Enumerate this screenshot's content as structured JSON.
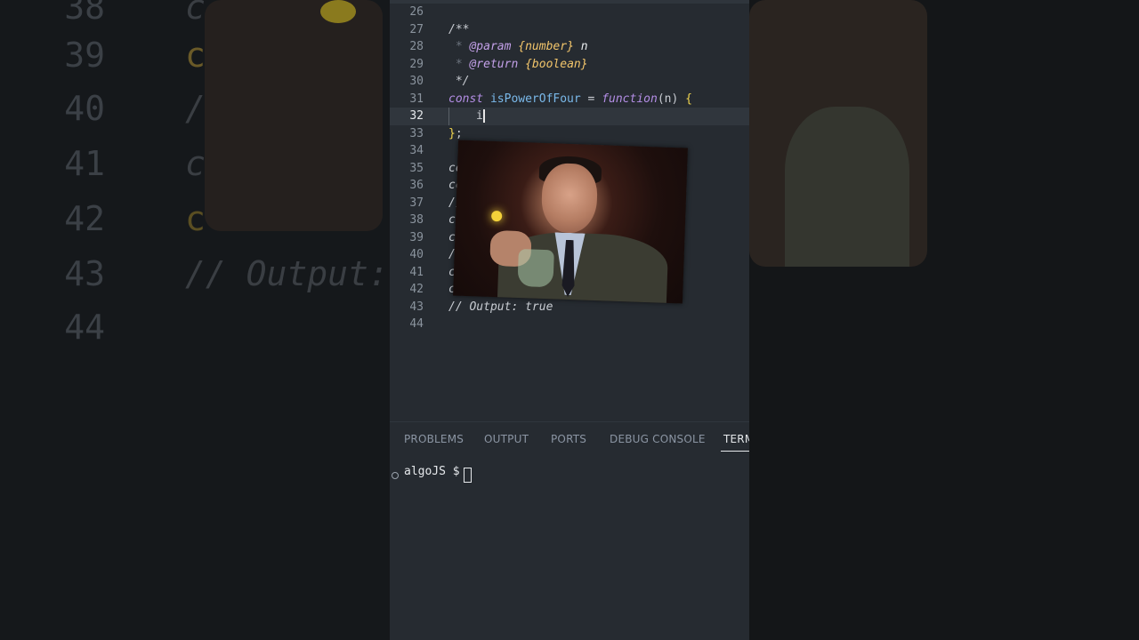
{
  "background": {
    "left_line_numbers": [
      "38",
      "39",
      "40",
      "41",
      "42",
      "43",
      "44"
    ],
    "left_code_fragment": "// Output:"
  },
  "editor": {
    "lines": [
      {
        "n": "26"
      },
      {
        "n": "27"
      },
      {
        "n": "28"
      },
      {
        "n": "29"
      },
      {
        "n": "30"
      },
      {
        "n": "31"
      },
      {
        "n": "32"
      },
      {
        "n": "33"
      },
      {
        "n": "34"
      },
      {
        "n": "35"
      },
      {
        "n": "36"
      },
      {
        "n": "37"
      },
      {
        "n": "38"
      },
      {
        "n": "39"
      },
      {
        "n": "40"
      },
      {
        "n": "41"
      },
      {
        "n": "42"
      },
      {
        "n": "43"
      },
      {
        "n": "44"
      }
    ],
    "code": {
      "l27": "/**",
      "l28_star": " * ",
      "l28_tag": "@param",
      "l28_type": "{number}",
      "l28_param": "n",
      "l29_star": " * ",
      "l29_tag": "@return",
      "l29_type": "{boolean}",
      "l30": " */",
      "l31_kw": "const",
      "l31_name": "isPowerOfFour",
      "l31_op": " = ",
      "l31_fn": "function",
      "l31_paren": "(n) ",
      "l31_brace": "{",
      "l32_text": "i",
      "l33_brace": "}",
      "l33_semi": ";",
      "l35": "co",
      "l36": "co",
      "l37": "//",
      "l38": "c",
      "l39": "c",
      "l40": "/",
      "l41": "c",
      "l42": "c",
      "l43": "// Output: true"
    }
  },
  "panel": {
    "tabs": [
      "PROBLEMS",
      "OUTPUT",
      "PORTS",
      "DEBUG CONSOLE",
      "TERM"
    ],
    "active_tab": "TERM",
    "terminal_prompt": "algoJS $ "
  },
  "colors": {
    "editor_bg": "#262b31",
    "keyword": "#b48ee6",
    "identifier": "#7ab9ea",
    "type": "#f2c56b",
    "brace": "#f2d64f",
    "comment": "#6b737d"
  }
}
